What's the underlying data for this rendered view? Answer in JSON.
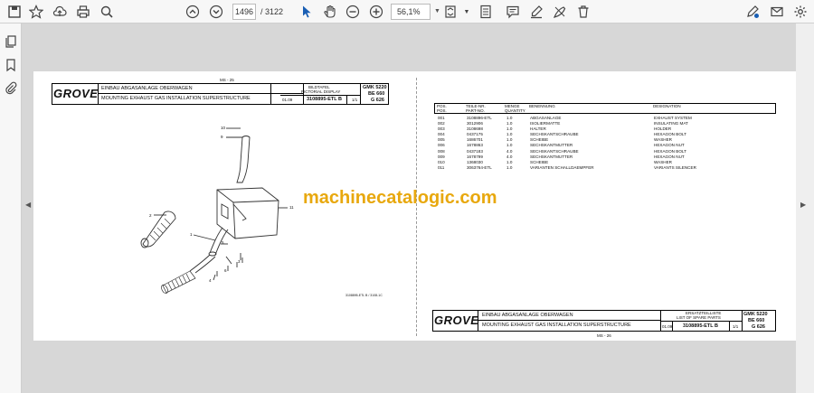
{
  "toolbar": {
    "current_page": "1496",
    "page_count": "/ 3122",
    "zoom": "56,1%"
  },
  "watermark": "machinecatalogic.com",
  "left_sheet": {
    "page_no": "MS - 25",
    "brand": "GROVE",
    "title_de": "EINBAU ABGASANLAGE OBERWAGEN",
    "title_en": "MOUNTING EXHAUST GAS INSTALLATION SUPERSTRUCTURE",
    "label_de": "BILDTAFEL",
    "label_en": "PICTORIAL DISPLAY",
    "date": "01.09",
    "part_no": "3108895-ETL B",
    "sheet": "1/1",
    "model1": "GMK 5220",
    "model2": "BE 660",
    "model3": "G 626",
    "drawing_ref": "3108895-ETL B / 3108-1C",
    "callouts": [
      "10",
      "9",
      "2",
      "1",
      "11",
      "5",
      "4",
      "6",
      "3"
    ]
  },
  "right_sheet": {
    "page_no": "MS - 26",
    "col_headers": [
      [
        "POS.",
        "POS."
      ],
      [
        "TEILE-NR.",
        "PART-NO."
      ],
      [
        "MENGE",
        "QUANTITY"
      ],
      [
        "BENENNUNG",
        ""
      ],
      [
        "DESIGNATION",
        ""
      ]
    ],
    "rows": [
      [
        "001",
        "3108896-ETL",
        "1.0",
        "ABGASANLAGE",
        "EXHAUST SYSTEM"
      ],
      [
        "002",
        "3012906",
        "1.0",
        "ISOLIERMATTE",
        "INSULATING MAT"
      ],
      [
        "003",
        "3108698",
        "1.0",
        "HALTER",
        "HOLDER"
      ],
      [
        "004",
        "0437175",
        "1.0",
        "SECHSKANTSCHRAUBE",
        "HEXAGON BOLT"
      ],
      [
        "005",
        "1686701",
        "1.0",
        "SCHEIBE",
        "WASHER"
      ],
      [
        "006",
        "1678863",
        "1.0",
        "SECHSKANTMUTTER",
        "HEXAGON NUT"
      ],
      [
        "008",
        "0437183",
        "4.0",
        "SECHSKANTSCHRAUBE",
        "HEXAGON BOLT"
      ],
      [
        "009",
        "1678799",
        "4.0",
        "SECHSKANTMUTTER",
        "HEXAGON NUT"
      ],
      [
        "010",
        "1368030",
        "1.0",
        "SCHEIBE",
        "WASHER"
      ],
      [
        "011",
        "3063764-ETL",
        "1.0",
        "VARIANTEN SCHALLDAEMPFER",
        "VARIANTS SILENCER"
      ]
    ],
    "brand": "GROVE",
    "title_de": "EINBAU ABGASANLAGE OBERWAGEN",
    "title_en": "MOUNTING EXHAUST GAS INSTALLATION SUPERSTRUCTURE",
    "label_de": "ERSATZTEILLISTE",
    "label_en": "LIST OF SPARE PARTS",
    "date": "01.09",
    "part_no": "3108895-ETL B",
    "sheet": "1/1",
    "model1": "GMK 5220",
    "model2": "BE 660",
    "model3": "G 626"
  }
}
